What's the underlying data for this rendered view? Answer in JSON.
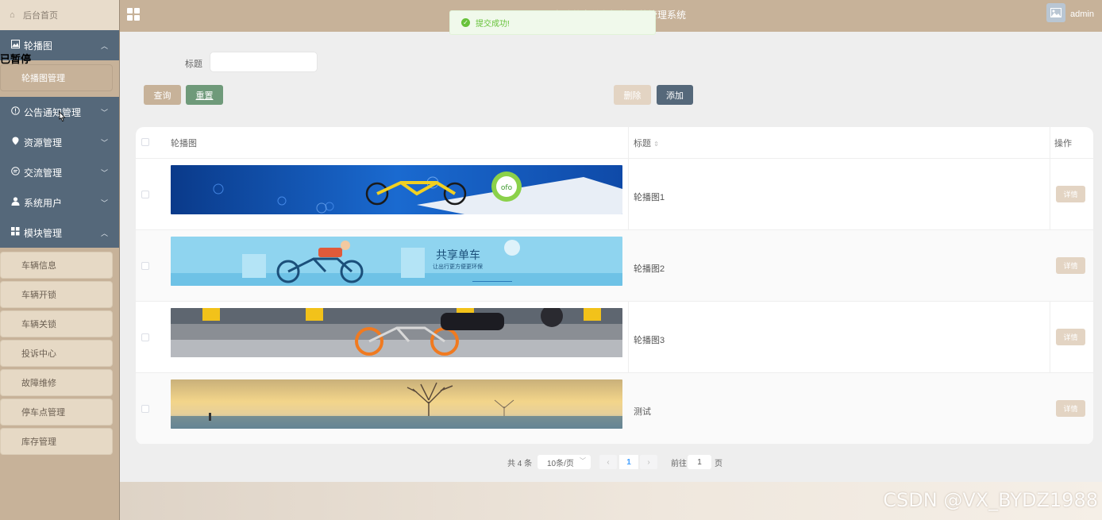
{
  "sidebar": {
    "home_label": "后台首页",
    "menus": [
      {
        "label": "轮播图",
        "icon": "image-icon",
        "expanded": true,
        "chevron": "up"
      },
      {
        "label": "公告通知管理",
        "icon": "info-icon",
        "chevron": "down"
      },
      {
        "label": "资源管理",
        "icon": "location-icon",
        "chevron": "down"
      },
      {
        "label": "交流管理",
        "icon": "chat-icon",
        "chevron": "down"
      },
      {
        "label": "系统用户",
        "icon": "user-icon",
        "chevron": "down"
      },
      {
        "label": "模块管理",
        "icon": "grid-icon",
        "expanded": true,
        "chevron": "up"
      }
    ],
    "carousel_sub": [
      "轮播图管理"
    ],
    "module_sub": [
      "车辆信息",
      "车辆开锁",
      "车辆关锁",
      "投诉中心",
      "故障维修",
      "停车点管理",
      "库存管理"
    ],
    "paused_text": "已暂停"
  },
  "header": {
    "title": "电动共享单车智能运营管理系统",
    "user": "admin"
  },
  "toast": {
    "message": "提交成功!",
    "color": "#67c23a"
  },
  "search": {
    "label": "标题",
    "value": "",
    "placeholder": ""
  },
  "buttons": {
    "query": "查询",
    "reset": "重置",
    "delete": "删除",
    "add": "添加"
  },
  "table": {
    "columns": [
      "轮播图",
      "标题",
      "操作"
    ],
    "rows": [
      {
        "title": "轮播图1",
        "action": "详情"
      },
      {
        "title": "轮播图2",
        "action": "详情"
      },
      {
        "title": "轮播图3",
        "action": "详情"
      },
      {
        "title": "测试",
        "action": "详情"
      }
    ],
    "banner2_text": "共享单车",
    "banner2_subtext": "让出行更方便更环保"
  },
  "pagination": {
    "total": "共 4 条",
    "page_size": "10条/页",
    "current": "1",
    "goto_label": "前往",
    "goto_value": "1",
    "page_suffix": "页"
  },
  "watermark": "CSDN @VX_BYDZ1988",
  "colors": {
    "sidebar_bg": "#c7b299",
    "menu_bg": "#55687a",
    "accent": "#c7b299",
    "success": "#67c23a"
  }
}
